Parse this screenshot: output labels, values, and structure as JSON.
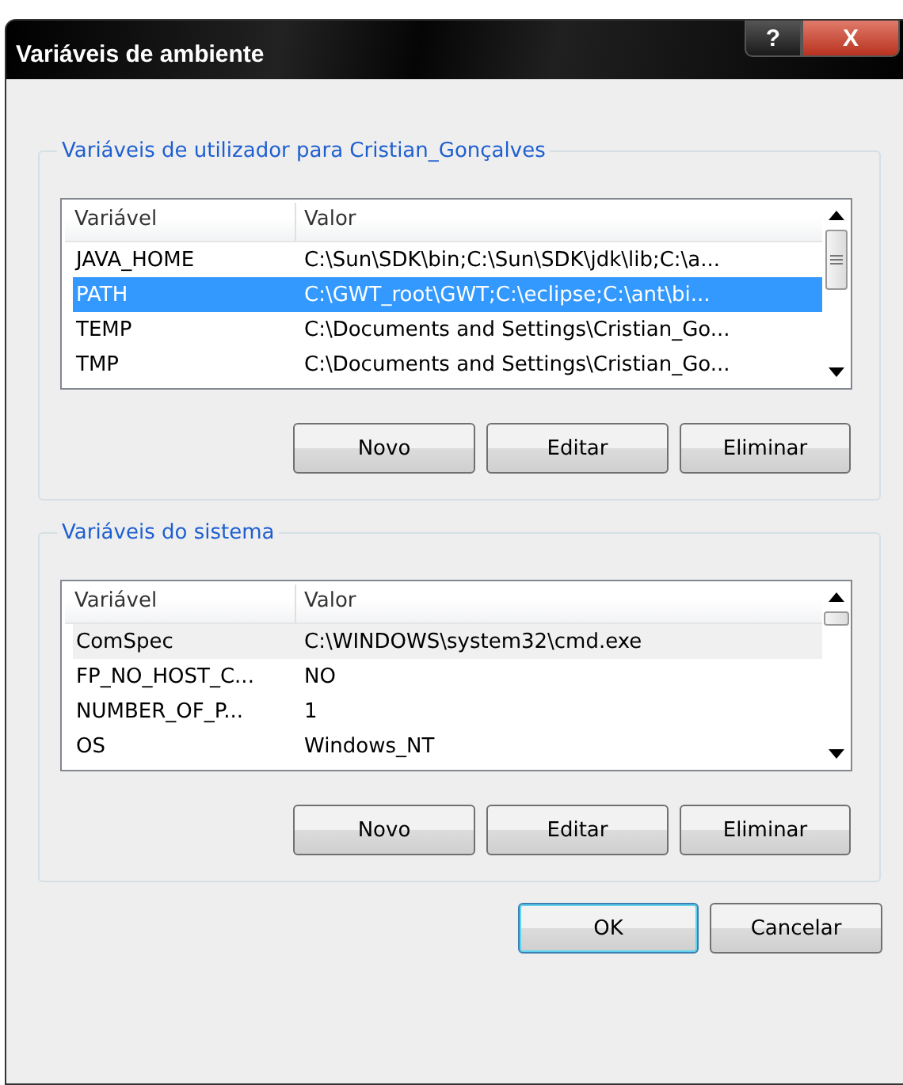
{
  "window": {
    "title": "Variáveis de ambiente"
  },
  "title_buttons": [
    {
      "kind": "help",
      "label": "?"
    },
    {
      "kind": "close",
      "label": "X"
    }
  ],
  "groups": [
    {
      "title": "Variáveis de utilizador para Cristian_Gonçalves",
      "focused": true,
      "columns": [
        "Variável",
        "Valor"
      ],
      "rows": [
        {
          "name": "JAVA_HOME",
          "value": "C:\\Sun\\SDK\\bin;C:\\Sun\\SDK\\jdk\\lib;C:\\a...",
          "selected": false
        },
        {
          "name": "PATH",
          "value": "C:\\GWT_root\\GWT;C:\\eclipse;C:\\ant\\bi...",
          "selected": true
        },
        {
          "name": "TEMP",
          "value": "C:\\Documents and Settings\\Cristian_Go...",
          "selected": false
        },
        {
          "name": "TMP",
          "value": "C:\\Documents and Settings\\Cristian_Go...",
          "selected": false
        }
      ],
      "buttons": [
        "Novo",
        "Editar",
        "Eliminar"
      ]
    },
    {
      "title": "Variáveis do sistema",
      "focused": false,
      "columns": [
        "Variável",
        "Valor"
      ],
      "rows": [
        {
          "name": "ComSpec",
          "value": "C:\\WINDOWS\\system32\\cmd.exe",
          "selected": true
        },
        {
          "name": "FP_NO_HOST_C...",
          "value": "NO",
          "selected": false
        },
        {
          "name": "NUMBER_OF_P...",
          "value": "1",
          "selected": false
        },
        {
          "name": "OS",
          "value": "Windows_NT",
          "selected": false
        }
      ],
      "buttons": [
        "Novo",
        "Editar",
        "Eliminar"
      ]
    }
  ],
  "dialog_buttons": [
    {
      "label": "OK",
      "default": true
    },
    {
      "label": "Cancelar",
      "default": false
    }
  ]
}
